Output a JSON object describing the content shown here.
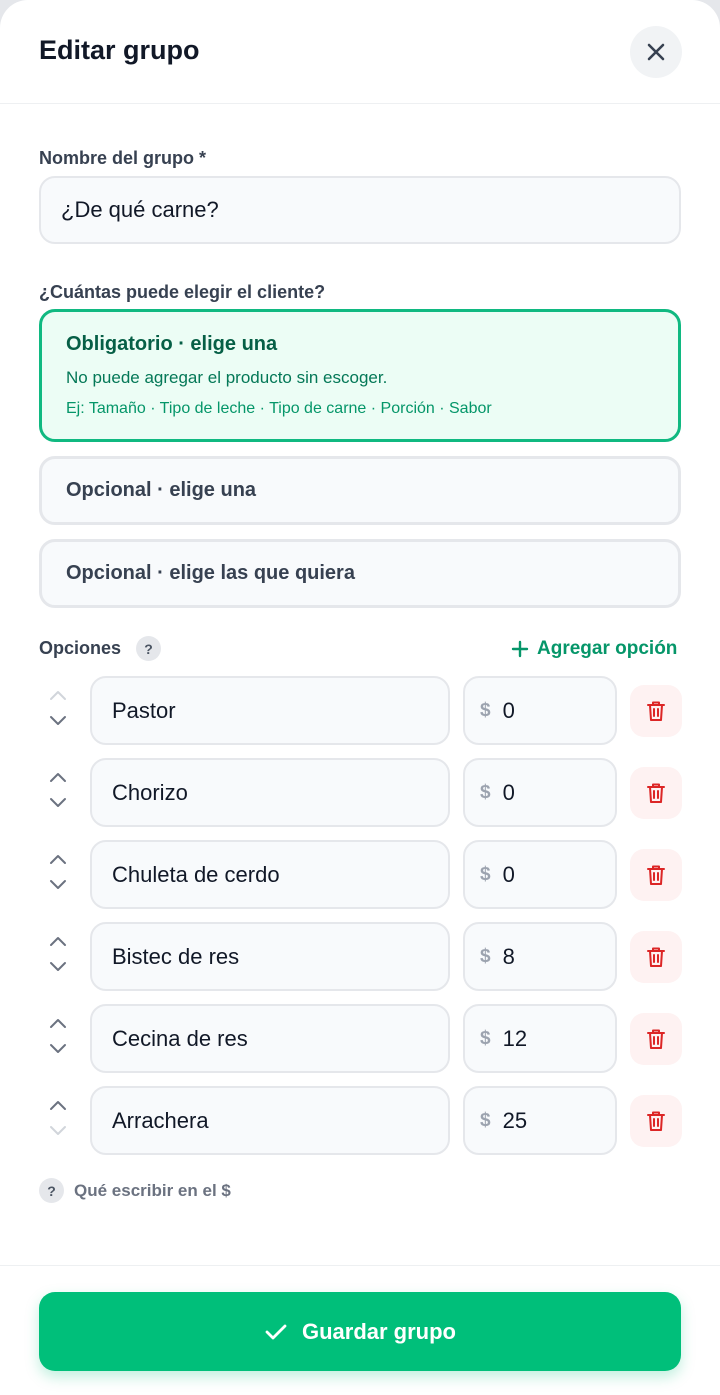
{
  "header": {
    "title": "Editar grupo",
    "close_icon": "close-icon"
  },
  "group_name": {
    "label": "Nombre del grupo *",
    "value": "¿De qué carne?"
  },
  "selection": {
    "label": "¿Cuántas puede elegir el cliente?",
    "options": [
      {
        "title": "Obligatorio · elige una",
        "description": "No puede agregar el producto sin escoger.",
        "examples": "Ej: Tamaño · Tipo de leche · Tipo de carne · Porción · Sabor",
        "selected": true
      },
      {
        "title": "Opcional · elige una",
        "selected": false
      },
      {
        "title": "Opcional · elige las que quiera",
        "selected": false
      }
    ]
  },
  "options_section": {
    "label": "Opciones",
    "help_mark": "?",
    "add_label": "Agregar opción",
    "currency": "$",
    "items": [
      {
        "name": "Pastor",
        "price": "0"
      },
      {
        "name": "Chorizo",
        "price": "0"
      },
      {
        "name": "Chuleta de cerdo",
        "price": "0"
      },
      {
        "name": "Bistec de res",
        "price": "8"
      },
      {
        "name": "Cecina de res",
        "price": "12"
      },
      {
        "name": "Arrachera",
        "price": "25"
      }
    ]
  },
  "help_link": {
    "mark": "?",
    "label": "Qué escribir en el $"
  },
  "footer": {
    "save_label": "Guardar grupo"
  },
  "colors": {
    "accent": "#00bf7a",
    "selected_border": "#10b981",
    "delete": "#dc2626"
  }
}
